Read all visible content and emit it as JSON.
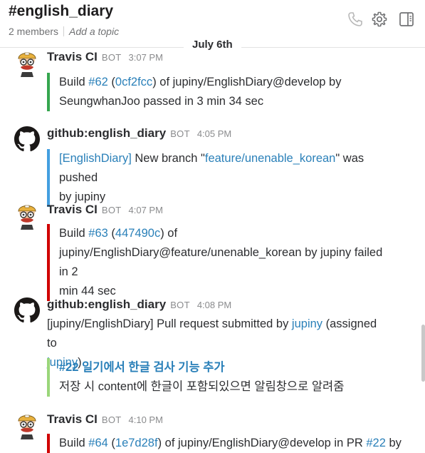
{
  "channel": {
    "name": "#english_diary",
    "members": "2 members",
    "topic_placeholder": "Add a topic"
  },
  "date_divider": "July 6th",
  "messages": [
    {
      "sender": "Travis CI",
      "bot_tag": "BOT",
      "time": "3:07 PM",
      "avatar": "travis-avatar",
      "parts": [
        "Build ",
        "#62",
        " (",
        "0cf2fcc",
        ") of jupiny/EnglishDiary@develop by",
        "SeungwhanJoo passed in 3 min 34 sec"
      ]
    },
    {
      "sender": "github:english_diary",
      "bot_tag": "BOT",
      "time": "4:05 PM",
      "avatar": "github-avatar",
      "parts": [
        "[EnglishDiary]",
        " New branch \"",
        "feature/unenable_korean",
        "\" was pushed",
        "by jupiny"
      ]
    },
    {
      "sender": "Travis CI",
      "bot_tag": "BOT",
      "time": "4:07 PM",
      "avatar": "travis-avatar",
      "parts": [
        "Build ",
        "#63",
        " (",
        "447490c",
        ") of",
        "jupiny/EnglishDiary@feature/unenable_korean by jupiny failed in 2",
        "min 44 sec"
      ]
    },
    {
      "sender": "github:english_diary",
      "bot_tag": "BOT",
      "time": "4:08 PM",
      "avatar": "github-avatar",
      "parts": [
        "[jupiny/EnglishDiary] Pull request submitted by ",
        "jupiny",
        " (assigned to",
        "jupiny",
        ")"
      ],
      "pr_title": "#22 일기에서 한글 검사 기능 추가",
      "pr_body": "저장 시 content에 한글이 포함되있으면 알림창으로 알려줌"
    },
    {
      "sender": "Travis CI",
      "bot_tag": "BOT",
      "time": "4:10 PM",
      "avatar": "travis-avatar",
      "parts": [
        "Build ",
        "#64",
        " (",
        "1e7d28f",
        ") of jupiny/EnglishDiary@develop in PR ",
        "#22",
        " by"
      ]
    }
  ],
  "colors": {
    "success": "#36a64f",
    "failure": "#d00000",
    "github": "#439fe0",
    "link": "#2a80b9"
  }
}
